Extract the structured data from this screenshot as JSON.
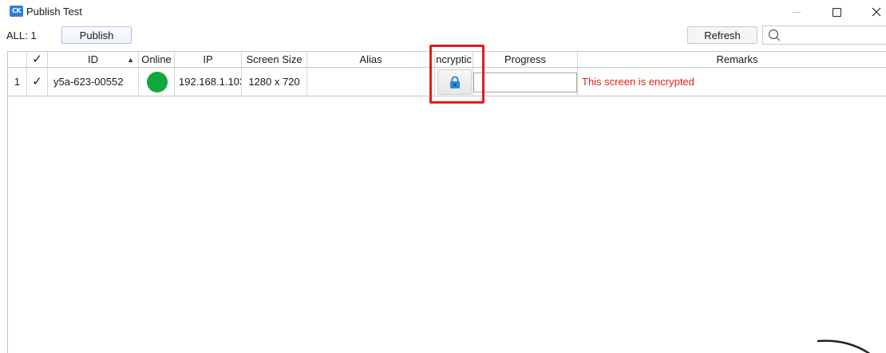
{
  "window": {
    "app_icon_text": "CK",
    "title": "Publish Test"
  },
  "toolbar": {
    "count_label": "ALL: 1",
    "publish_label": "Publish",
    "refresh_label": "Refresh",
    "search_placeholder": "",
    "search_value": ""
  },
  "table": {
    "columns": {
      "select": "✓",
      "id": "ID",
      "online": "Online",
      "ip": "IP",
      "screen_size": "Screen Size",
      "alias": "Alias",
      "encryption": "ncryptic",
      "progress": "Progress",
      "remarks": "Remarks"
    },
    "sort": {
      "column": "ID",
      "direction": "ascending"
    },
    "rows": [
      {
        "index": "1",
        "checked": "✓",
        "id": "y5a-623-00552",
        "online_status": "online",
        "online_color": "#11a83f",
        "ip": "192.168.1.103",
        "screen_size": "1280 x 720",
        "alias": "",
        "encryption_icon": "lock-icon",
        "progress": "",
        "remarks": "This screen is encrypted",
        "remarks_color": "#e02020"
      }
    ]
  },
  "annotation": {
    "highlight_color": "#e51b1b",
    "highlighted_column": "encryption"
  },
  "colors": {
    "accent": "#2f7fd8",
    "online": "#11a83f",
    "error_text": "#e02020"
  }
}
